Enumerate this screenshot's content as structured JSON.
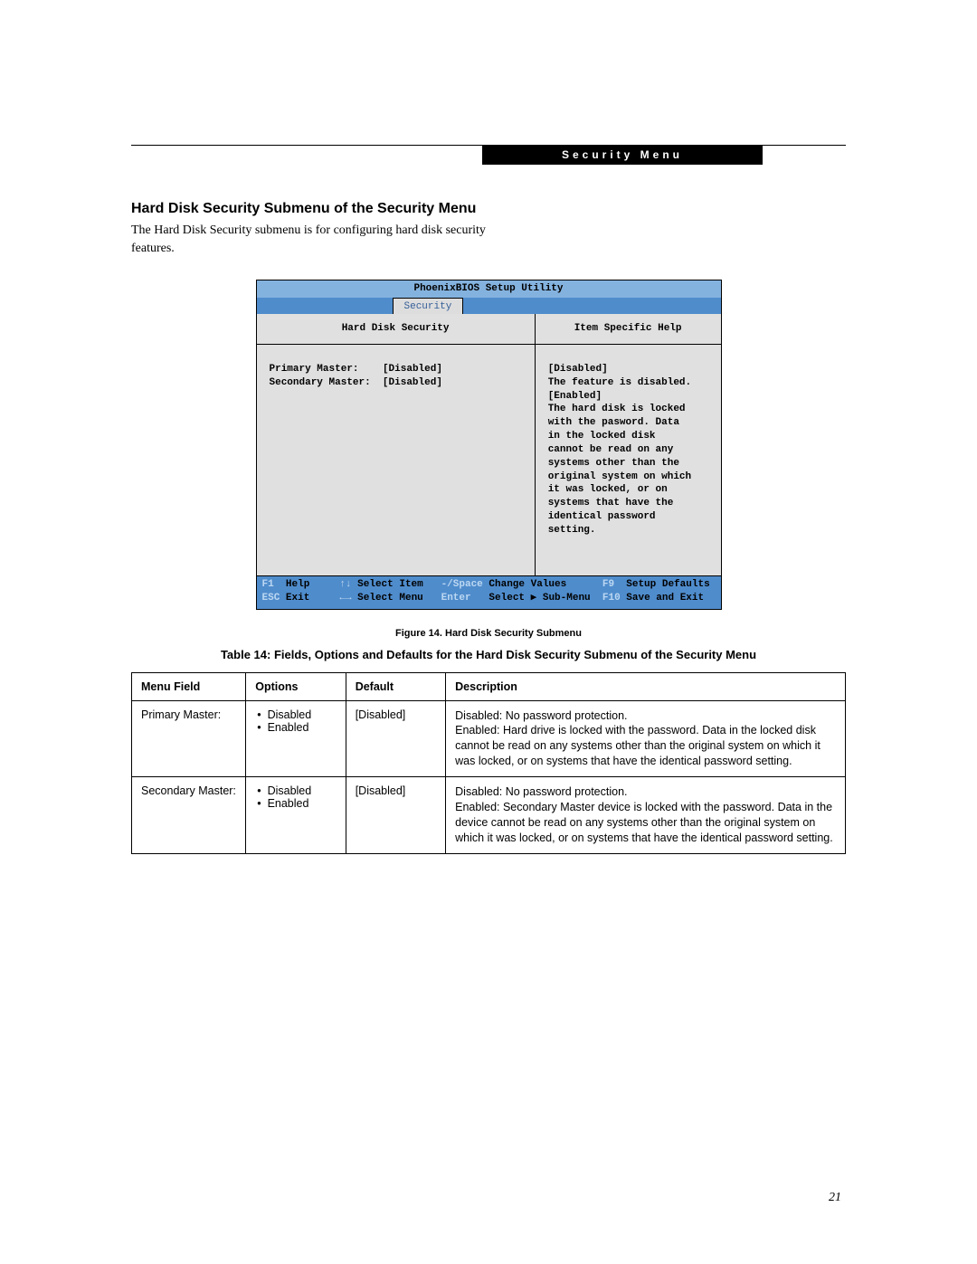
{
  "header_bar": "Security Menu",
  "section_title": "Hard Disk Security Submenu of the Security Menu",
  "intro_text": "The Hard Disk Security submenu is for configuring hard disk security features.",
  "bios": {
    "title": "PhoenixBIOS Setup Utility",
    "active_tab": "Security",
    "submenu_title": "Hard Disk Security",
    "help_title": "Item Specific Help",
    "fields": {
      "primary_label": "Primary Master:",
      "primary_value": "[Disabled]",
      "secondary_label": "Secondary Master:",
      "secondary_value": "[Disabled]"
    },
    "help_text_lines": [
      "[Disabled]",
      "The feature is disabled.",
      "",
      "[Enabled]",
      "The hard disk is locked",
      "with the pasword. Data",
      "in the locked disk",
      "cannot be read on any",
      "systems other than the",
      "original system on which",
      "it was locked, or on",
      "systems that have the",
      "identical password",
      "setting."
    ],
    "footer": {
      "f1": "F1",
      "help": "Help",
      "select_item_key": "↑↓",
      "select_item": "Select Item",
      "change_values_key": "-/Space",
      "change_values": "Change Values",
      "f9": "F9",
      "setup_defaults": "Setup Defaults",
      "esc": "ESC",
      "exit": "Exit",
      "select_menu_key": "←→",
      "select_menu": "Select Menu",
      "enter": "Enter",
      "select_sub": "Select ▶ Sub-Menu",
      "f10": "F10",
      "save_exit": "Save and Exit"
    }
  },
  "figure_caption": "Figure 14.   Hard Disk Security Submenu",
  "table_caption": "Table 14: Fields, Options and Defaults for the Hard Disk Security Submenu of the Security Menu",
  "table": {
    "headers": {
      "menu_field": "Menu Field",
      "options": "Options",
      "default": "Default",
      "description": "Description"
    },
    "rows": [
      {
        "menu_field": "Primary Master:",
        "options": [
          "Disabled",
          "Enabled"
        ],
        "default": "[Disabled]",
        "description": "Disabled: No password protection.\nEnabled: Hard drive is locked with the password. Data in the locked disk cannot be read on any systems other than the original system on which it was locked, or on systems that have the identical password setting."
      },
      {
        "menu_field": "Secondary Master:",
        "options": [
          "Disabled",
          "Enabled"
        ],
        "default": "[Disabled]",
        "description": "Disabled: No password protection.\nEnabled: Secondary Master device is locked with the password. Data in the device cannot be read on any systems other than the original system on which it was locked, or on systems that have the identical password setting."
      }
    ]
  },
  "page_number": "21"
}
